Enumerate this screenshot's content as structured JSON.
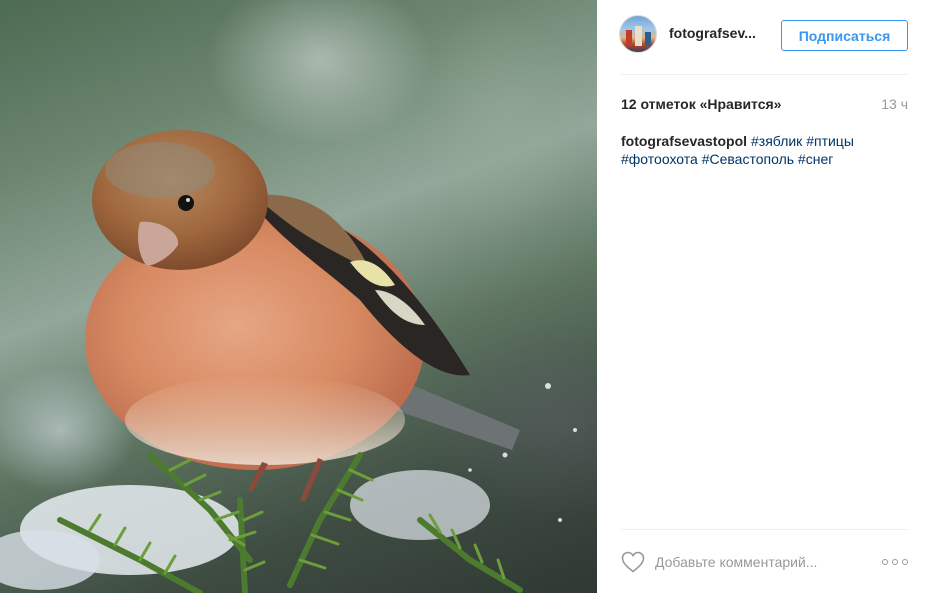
{
  "post": {
    "image_alt": "зяблик на ветке",
    "header": {
      "username": "fotografsev...",
      "follow_label": "Подписаться"
    },
    "stats": {
      "likes": "12 отметок «Нравится»",
      "time": "13 ч"
    },
    "caption": {
      "author": "fotografsevastopol",
      "hashtags": [
        "#зяблик",
        "#птицы",
        "#фотоохота",
        "#Севастополь",
        "#снег"
      ]
    },
    "footer": {
      "comment_placeholder": "Добавьте комментарий...",
      "like_icon": "heart-outline-icon",
      "more_icon": "more-options-icon"
    }
  },
  "colors": {
    "accent": "#3897f0",
    "hashtag": "#003569",
    "muted": "#999999",
    "text": "#262626"
  }
}
